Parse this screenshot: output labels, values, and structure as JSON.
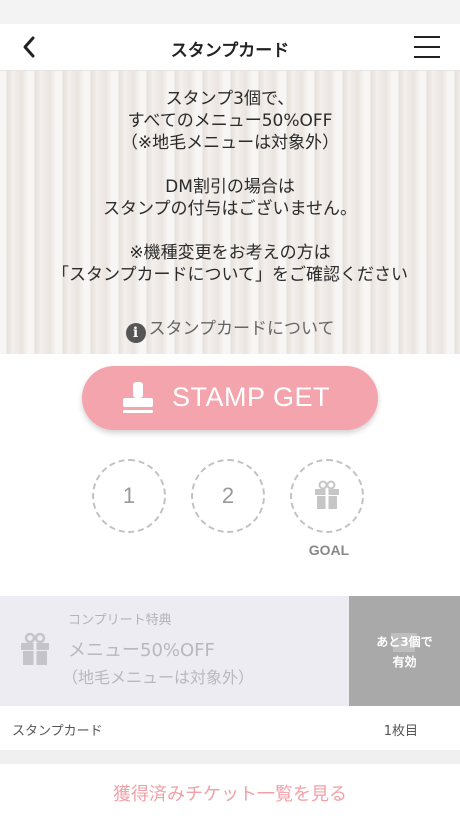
{
  "nav": {
    "title": "スタンプカード",
    "back_icon": "chevron-left-icon",
    "menu_icon": "hamburger-menu-icon"
  },
  "notice": {
    "lines_block1": [
      "スタンプ3個で、",
      "すべてのメニュー50%OFF",
      "（※地毛メニューは対象外）"
    ],
    "lines_block2": [
      "DM割引の場合は",
      "スタンプの付与はございません。"
    ],
    "lines_block3": [
      "※機種変更をお考えの方は",
      "「スタンプカードについて」をご確認ください"
    ],
    "about_link": "スタンプカードについて",
    "info_icon": "info-icon",
    "info_glyph": "i"
  },
  "stamp_button": {
    "label": "STAMP GET",
    "icon": "stamp-icon",
    "color": "#f4a4ad"
  },
  "stamps": {
    "slot1": "1",
    "slot2": "2",
    "goal_icon": "gift-icon",
    "goal_label": "GOAL"
  },
  "reward": {
    "caption": "コンプリート特典",
    "line1": "メニュー50%OFF",
    "line2": "（地毛メニューは対象外）",
    "icon": "gift-icon",
    "status_line1": "あと3個で",
    "status_line2": "有効"
  },
  "card": {
    "label": "スタンプカード",
    "count": "1枚目"
  },
  "tickets_link": "獲得済みチケット一覧を見る"
}
